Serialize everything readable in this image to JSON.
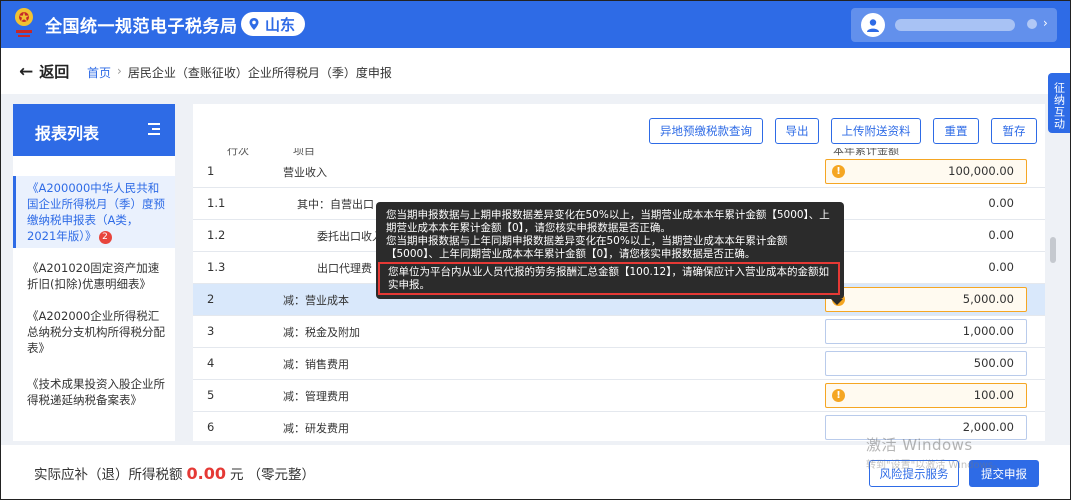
{
  "header": {
    "brand": "全国统一规范电子税务局",
    "region": "山东",
    "colors": {
      "primary": "#2e6be6",
      "warning": "#f5a623",
      "danger": "#e53935"
    }
  },
  "nav": {
    "back_label": "返回",
    "breadcrumb": {
      "home": "首页",
      "separator": "›",
      "current": "居民企业（查账征收）企业所得税月（季）度申报"
    }
  },
  "side_tab": {
    "label": "征纳互动"
  },
  "left_panel": {
    "title": "报表列表",
    "items": [
      {
        "label": "《A200000中华人民共和国企业所得税月（季）度预缴纳税申报表（A类，2021年版）》",
        "badge": "2"
      },
      {
        "label": "《A201020固定资产加速折旧(扣除)优惠明细表》"
      },
      {
        "label": "《A202000企业所得税汇总纳税分支机构所得税分配表》"
      },
      {
        "label": "《技术成果投资入股企业所得税递延纳税备案表》"
      }
    ]
  },
  "toolbar": {
    "buttons": [
      "异地预缴税款查询",
      "导出",
      "上传附送资料",
      "重置",
      "暂存"
    ]
  },
  "table": {
    "header_partial": [
      "行次",
      "项目",
      "本年累计金额"
    ],
    "rows": [
      {
        "no": "1",
        "name": "营业收入",
        "amount": "100,000.00",
        "warn": true
      },
      {
        "no": "1.1",
        "name": "其中：自营出口",
        "amount": "0.00",
        "warn": false
      },
      {
        "no": "1.2",
        "name": "委托出口收入",
        "amount": "0.00",
        "warn": false
      },
      {
        "no": "1.3",
        "name": "出口代理费",
        "amount": "0.00",
        "warn": false
      },
      {
        "no": "2",
        "name": "减：营业成本",
        "amount": "5,000.00",
        "warn": true,
        "highlight": true
      },
      {
        "no": "3",
        "name": "减：税金及附加",
        "amount": "1,000.00",
        "warn": false
      },
      {
        "no": "4",
        "name": "减：销售费用",
        "amount": "500.00",
        "warn": false
      },
      {
        "no": "5",
        "name": "减：管理费用",
        "amount": "100.00",
        "warn": true
      },
      {
        "no": "6",
        "name": "减：研发费用",
        "amount": "2,000.00",
        "warn": false
      }
    ]
  },
  "tooltip": {
    "line1": "您当期申报数据与上期申报数据差异变化在50%以上，当期营业成本本年累计金额【5000】、上期营业成本本年累计金额【0】，请您核实申报数据是否正确。",
    "line2": "您当期申报数据与上年同期申报数据差异变化在50%以上，当期营业成本本年累计金额【5000】、上年同期营业成本本年累计金额【0】，请您核实申报数据是否正确。",
    "line3": "您单位为平台内从业人员代报的劳务报酬汇总金额【100.12】，请确保应计入营业成本的金额如实申报。"
  },
  "footer": {
    "tax_label": "实际应补（退）所得税额",
    "tax_value": "0.00",
    "tax_unit": "元",
    "tax_words": "（零元整）",
    "risk_button": "风险提示服务",
    "submit_button": "提交申报"
  },
  "watermark": {
    "line1": "激活 Windows",
    "line2": "转到\"设置\"以激活 Windows。"
  }
}
